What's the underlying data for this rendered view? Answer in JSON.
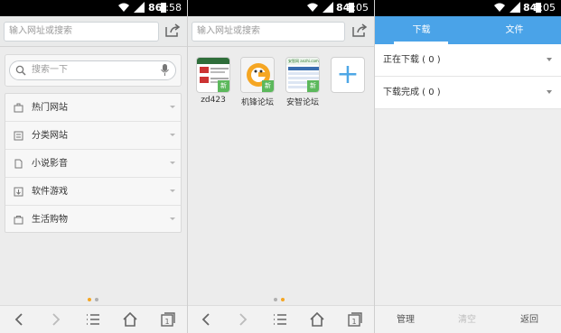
{
  "colors": {
    "accent": "#4aa3e8",
    "dot_active": "#f5a623",
    "dot_inactive": "#b0b0b0"
  },
  "panel1": {
    "status": {
      "battery": "86",
      "time": "2:58"
    },
    "url_placeholder": "输入网址或搜索",
    "search_placeholder": "搜索一下",
    "categories": [
      {
        "label": "热门网站",
        "icon": "hot-sites-icon"
      },
      {
        "label": "分类网站",
        "icon": "category-sites-icon"
      },
      {
        "label": "小说影音",
        "icon": "novel-media-icon"
      },
      {
        "label": "软件游戏",
        "icon": "software-games-icon"
      },
      {
        "label": "生活购物",
        "icon": "shopping-icon"
      }
    ]
  },
  "panel2": {
    "status": {
      "battery": "84",
      "time": "3:05"
    },
    "url_placeholder": "输入网址或搜索",
    "tiles": [
      {
        "label": "zd423",
        "thumb_text": "zd423",
        "badge": "新"
      },
      {
        "label": "机锋论坛",
        "thumb_text": "",
        "badge": "新"
      },
      {
        "label": "安智论坛",
        "thumb_text": "安智网 anzhi.com",
        "badge": "新"
      }
    ],
    "add_symbol": "+"
  },
  "panel3": {
    "status": {
      "battery": "84",
      "time": "3:05"
    },
    "tabs": {
      "download": "下载",
      "files": "文件"
    },
    "downloading": "正在下载 ( 0 )",
    "completed": "下载完成 ( 0 )",
    "bottom": {
      "manage": "管理",
      "clear": "清空",
      "back": "返回"
    }
  }
}
